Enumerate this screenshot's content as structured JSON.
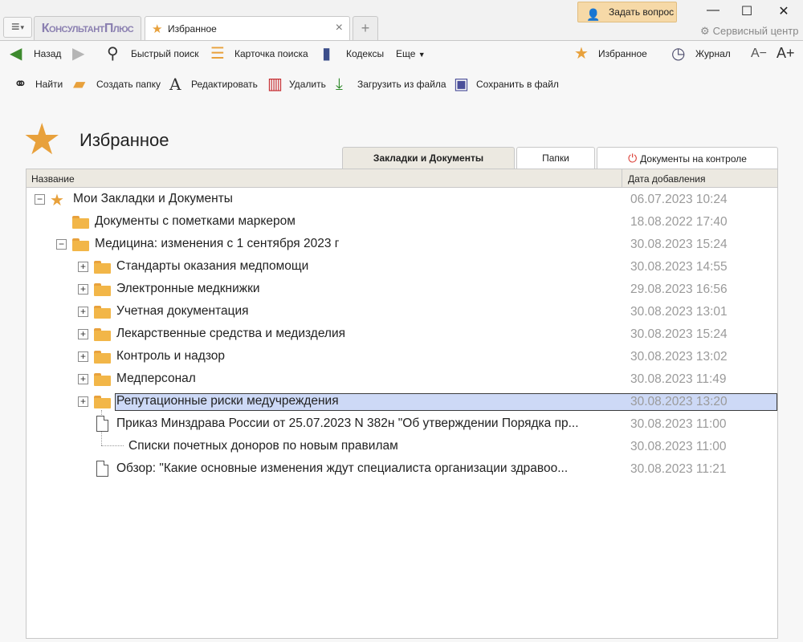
{
  "window": {
    "logo": "КонсультантПлюс",
    "active_tab": "Избранное",
    "ask_button": "Задать вопрос",
    "service_center": "Сервисный центр",
    "minimize": "—",
    "maximize": "☐",
    "close": "✕"
  },
  "navbar": {
    "back": "Назад",
    "quick_search": "Быстрый поиск",
    "search_card": "Карточка поиска",
    "codes": "Кодексы",
    "more": "Еще",
    "favorites": "Избранное",
    "journal": "Журнал",
    "font_smaller": "A−",
    "font_larger": "A+"
  },
  "toolbar": {
    "find": "Найти",
    "create_folder": "Создать папку",
    "edit": "Редактировать",
    "delete": "Удалить",
    "load_file": "Загрузить из файла",
    "save_file": "Сохранить в файл"
  },
  "page": {
    "title": "Избранное"
  },
  "tabs": {
    "bookmarks": "Закладки и Документы",
    "folders": "Папки",
    "control": "Документы на контроле"
  },
  "table": {
    "col_name": "Название",
    "col_date": "Дата добавления"
  },
  "rows": [
    {
      "label": "Мои Закладки и Документы",
      "date": "06.07.2023 10:24"
    },
    {
      "label": "Документы с пометками маркером",
      "date": "18.08.2022 17:40"
    },
    {
      "label": "Медицина: изменения с 1 сентября 2023 г",
      "date": "30.08.2023 15:24"
    },
    {
      "label": "Стандарты оказания медпомощи",
      "date": "30.08.2023 14:55"
    },
    {
      "label": "Электронные медкнижки",
      "date": "29.08.2023 16:56"
    },
    {
      "label": "Учетная документация",
      "date": "30.08.2023 13:01"
    },
    {
      "label": "Лекарственные средства и медизделия",
      "date": "30.08.2023 15:24"
    },
    {
      "label": "Контроль и надзор",
      "date": "30.08.2023 13:02"
    },
    {
      "label": "Медперсонал",
      "date": "30.08.2023 11:49"
    },
    {
      "label": "Репутационные риски медучреждения",
      "date": "30.08.2023 13:20"
    },
    {
      "label": "Приказ Минздрава России от 25.07.2023 N 382н \"Об утверждении Порядка пр...",
      "date": "30.08.2023 11:00"
    },
    {
      "label": "Списки почетных доноров по новым правилам",
      "date": "30.08.2023 11:00"
    },
    {
      "label": "Обзор: \"Какие основные изменения ждут специалиста организации здравоо...",
      "date": "30.08.2023 11:21"
    }
  ]
}
